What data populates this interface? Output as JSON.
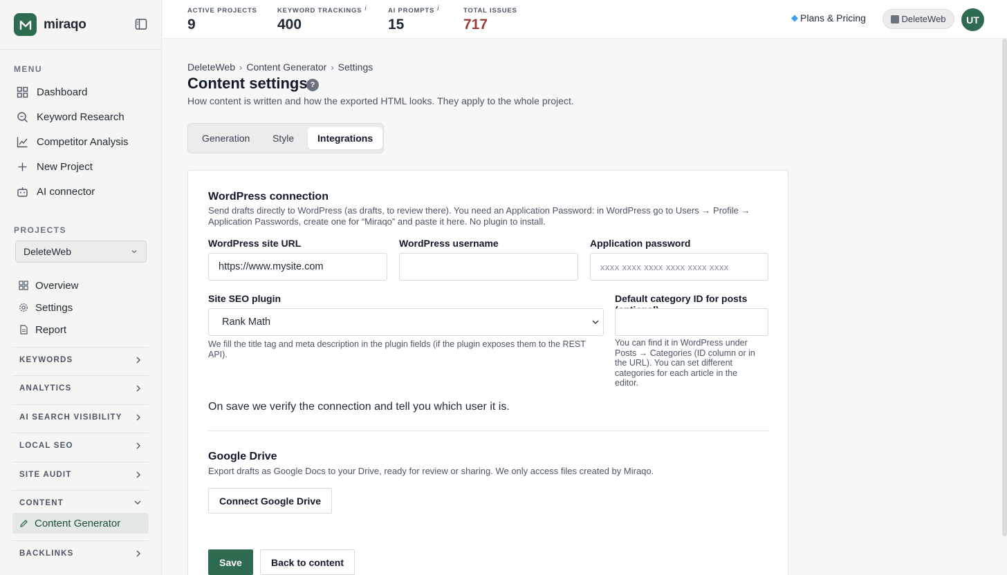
{
  "brand": {
    "name": "miraqo"
  },
  "sidebar": {
    "menu_title": "MENU",
    "menu": [
      {
        "label": "Dashboard",
        "icon": "grid-icon"
      },
      {
        "label": "Keyword Research",
        "icon": "search-icon"
      },
      {
        "label": "Competitor Analysis",
        "icon": "chart-line-icon"
      },
      {
        "label": "New Project",
        "icon": "plus-icon"
      },
      {
        "label": "AI connector",
        "icon": "robot-icon"
      }
    ],
    "projects_title": "PROJECTS",
    "project_selected": "DeleteWeb",
    "project_items": [
      {
        "label": "Overview",
        "icon": "grid-icon"
      },
      {
        "label": "Settings",
        "icon": "gear-icon"
      },
      {
        "label": "Report",
        "icon": "document-icon"
      }
    ],
    "groups": [
      "KEYWORDS",
      "ANALYTICS",
      "AI SEARCH VISIBILITY",
      "LOCAL SEO",
      "SITE AUDIT",
      "CONTENT",
      "BACKLINKS"
    ],
    "active_item": "Content Generator"
  },
  "topbar": {
    "stats": [
      {
        "label": "ACTIVE PROJECTS",
        "value": "9",
        "info": ""
      },
      {
        "label": "KEYWORD TRACKINGS",
        "value": "400",
        "info": "i"
      },
      {
        "label": "AI PROMPTS",
        "value": "15",
        "info": "i"
      },
      {
        "label": "TOTAL ISSUES",
        "value": "717",
        "info": ""
      }
    ],
    "plans_label": "Plans & Pricing",
    "workspace": "DeleteWeb",
    "avatar": "UT"
  },
  "breadcrumb": [
    "DeleteWeb",
    "Content Generator",
    "Settings"
  ],
  "page": {
    "title": "Content settings",
    "help": "?",
    "description": "How content is written and how the exported HTML looks. They apply to the whole project."
  },
  "tabs": [
    "Generation",
    "Style",
    "Integrations"
  ],
  "active_tab": "Integrations",
  "wordpress": {
    "title": "WordPress connection",
    "description": "Send drafts directly to WordPress (as drafts, to review there). You need an Application Password: in WordPress go to Users → Profile → Application Passwords, create one for “Miraqo” and paste it here. No plugin to install.",
    "site_url_label": "WordPress site URL",
    "site_url_value": "https://www.mysite.com",
    "username_label": "WordPress username",
    "username_value": "",
    "password_label": "Application password",
    "password_placeholder": "xxxx xxxx xxxx xxxx xxxx xxxx",
    "seo_plugin_label": "Site SEO plugin",
    "seo_plugin_value": "Rank Math",
    "seo_plugin_note": "We fill the title tag and meta description in the plugin fields (if the plugin exposes them to the REST API).",
    "category_label": "Default category ID for posts (optional)",
    "category_value": "",
    "category_note": "You can find it in WordPress under Posts → Categories (ID column or in the URL). You can set different categories for each article in the editor.",
    "verify_note": "On save we verify the connection and tell you which user it is."
  },
  "gdrive": {
    "title": "Google Drive",
    "description": "Export drafts as Google Docs to your Drive, ready for review or sharing. We only access files created by Miraqo.",
    "connect_label": "Connect Google Drive"
  },
  "actions": {
    "save": "Save",
    "back": "Back to content"
  },
  "colors": {
    "brand": "#2f6b4f",
    "issues": "#9b3b36"
  }
}
